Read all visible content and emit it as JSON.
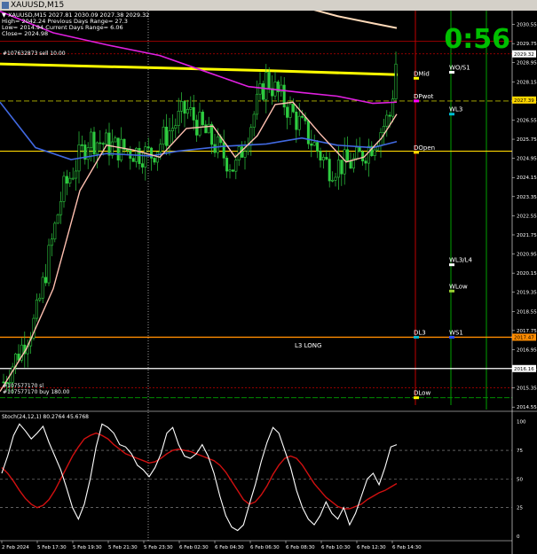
{
  "window": {
    "title": "XAUUSD,M15"
  },
  "header": {
    "symbol_line": "XAUUSD,M15",
    "ohlc": "2027.81 2030.09 2027.38 2029.32",
    "high": "High= 2042.24",
    "low": "Low= 2014.94",
    "close": "Close= 2024.98",
    "prev_range": "Previous Days Range= 27.3",
    "cur_range": "Current Days Range= 6.06"
  },
  "countdown": "0:56",
  "orders": {
    "sell": "#107632873 sell 10.00",
    "sl": "#107577170 sl",
    "buy": "#107577170 buy 180.00"
  },
  "levels": [
    {
      "name": "DMid",
      "price": 2028.3,
      "color": "#ffffff",
      "flag": "#ffff00"
    },
    {
      "name": "DPwot",
      "price": 2027.35,
      "color": "#ffffff",
      "flag": "#ff00ff"
    },
    {
      "name": "DOpen",
      "price": 2025.2,
      "color": "#ffffff",
      "flag": "#ffd700"
    },
    {
      "name": "DL3",
      "price": 2017.47,
      "color": "#ffffff",
      "flag": "#00bcd4"
    },
    {
      "name": "DLow",
      "price": 2014.94,
      "color": "#ffffff",
      "flag": "#ffff00"
    },
    {
      "name": "WO/S1",
      "price": 2028.55,
      "color": "#ffffff",
      "flag": "#ffffff"
    },
    {
      "name": "WL3",
      "price": 2026.8,
      "color": "#ffffff",
      "flag": "#00bcd4"
    },
    {
      "name": "WL3/L4",
      "price": 2020.5,
      "color": "#ffffff",
      "flag": "#ffffff"
    },
    {
      "name": "WLow",
      "price": 2019.4,
      "color": "#ffffff",
      "flag": "#9acd32"
    },
    {
      "name": "WS1",
      "price": 2017.47,
      "color": "#ffffff",
      "flag": "#3050ff"
    }
  ],
  "l3_long_label": "L3 LONG",
  "price_axis": {
    "ticks": [
      "2031.35",
      "2030.55",
      "2029.75",
      "2028.95",
      "2028.15",
      "2027.35",
      "2026.55",
      "2025.75",
      "2024.95",
      "2024.15",
      "2023.35",
      "2022.55",
      "2021.75",
      "2020.95",
      "2020.15",
      "2019.35",
      "2018.55",
      "2017.75",
      "2016.95",
      "2016.15",
      "2015.35",
      "2014.55"
    ],
    "markers": [
      {
        "label": "2029.32",
        "price": 2029.32,
        "bg": "#ffffff",
        "fg": "#000000"
      },
      {
        "label": "2027.39",
        "price": 2027.39,
        "bg": "#ffd700",
        "fg": "#000000"
      },
      {
        "label": "2017.47",
        "price": 2017.47,
        "bg": "#ff8c00",
        "fg": "#000000"
      },
      {
        "label": "2016.16",
        "price": 2016.16,
        "bg": "#ffffff",
        "fg": "#000000"
      }
    ]
  },
  "stoch": {
    "label": "Stoch(24,12,1) 80.2764 45.6768",
    "ticks": [
      "100",
      "75",
      "50",
      "25",
      "0"
    ],
    "main": [
      55,
      70,
      88,
      98,
      92,
      85,
      90,
      96,
      82,
      70,
      58,
      42,
      25,
      15,
      28,
      50,
      78,
      98,
      95,
      90,
      80,
      78,
      72,
      62,
      58,
      52,
      60,
      72,
      90,
      95,
      80,
      70,
      68,
      72,
      80,
      70,
      55,
      35,
      18,
      8,
      5,
      10,
      28,
      45,
      65,
      82,
      95,
      90,
      75,
      60,
      40,
      25,
      15,
      10,
      18,
      30,
      20,
      15,
      25,
      10,
      20,
      35,
      50,
      55,
      45,
      60,
      78,
      80
    ],
    "signal": [
      60,
      55,
      48,
      40,
      33,
      28,
      25,
      27,
      32,
      40,
      50,
      60,
      70,
      78,
      85,
      88,
      90,
      88,
      85,
      80,
      76,
      72,
      70,
      68,
      66,
      64,
      65,
      68,
      72,
      75,
      76,
      75,
      74,
      72,
      70,
      68,
      66,
      62,
      56,
      48,
      40,
      32,
      28,
      30,
      36,
      44,
      54,
      62,
      68,
      70,
      68,
      62,
      54,
      46,
      40,
      34,
      30,
      26,
      24,
      24,
      26,
      28,
      32,
      35,
      38,
      40,
      43,
      46
    ]
  },
  "time_axis": [
    "2 Feb 2024",
    "5 Feb 17:30",
    "5 Feb 19:30",
    "5 Feb 21:30",
    "5 Feb 23:30",
    "6 Feb 02:30",
    "6 Feb 04:30",
    "6 Feb 06:30",
    "6 Feb 08:30",
    "6 Feb 10:30",
    "6 Feb 12:30",
    "6 Feb 14:30"
  ]
}
